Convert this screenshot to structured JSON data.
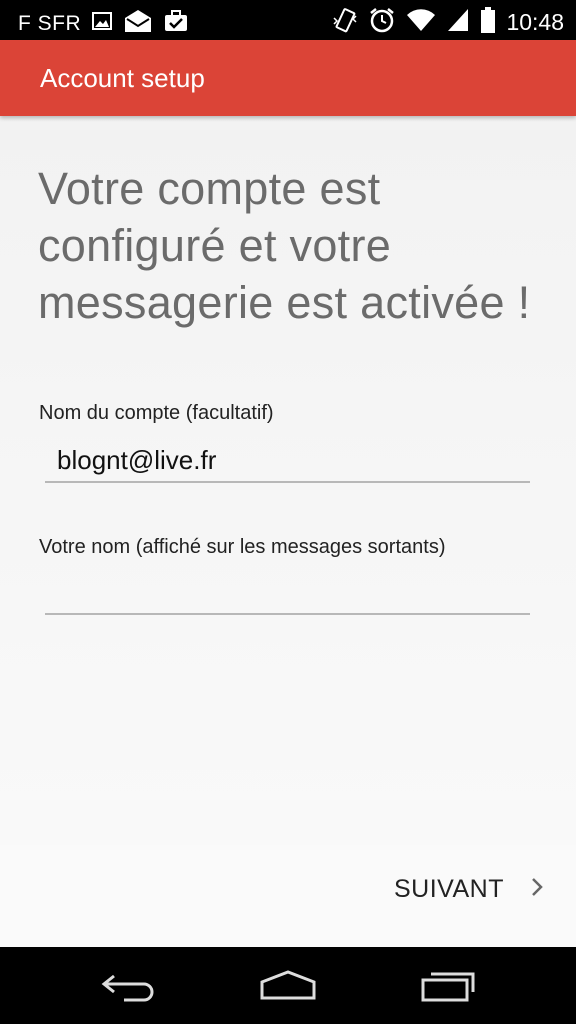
{
  "status_bar": {
    "carrier": "F SFR",
    "time": "10:48",
    "icons_left": [
      "image-icon",
      "mail-icon",
      "briefcase-check-icon"
    ],
    "icons_right": [
      "vibrate-icon",
      "alarm-icon",
      "wifi-icon",
      "signal-icon",
      "battery-icon"
    ]
  },
  "app_bar": {
    "title": "Account setup",
    "color": "#db4437"
  },
  "main": {
    "headline": "Votre compte est configuré et votre messagerie est activée !",
    "account_name_label": "Nom du compte (facultatif)",
    "account_name_value": "blognt@live.fr",
    "your_name_label": "Votre nom (affiché sur les messages sortants)",
    "your_name_value": ""
  },
  "actions": {
    "next_label": "SUIVANT",
    "next_icon": "chevron-right-icon"
  },
  "nav_bar": {
    "icons": [
      "back-icon",
      "home-icon",
      "recent-apps-icon"
    ]
  }
}
